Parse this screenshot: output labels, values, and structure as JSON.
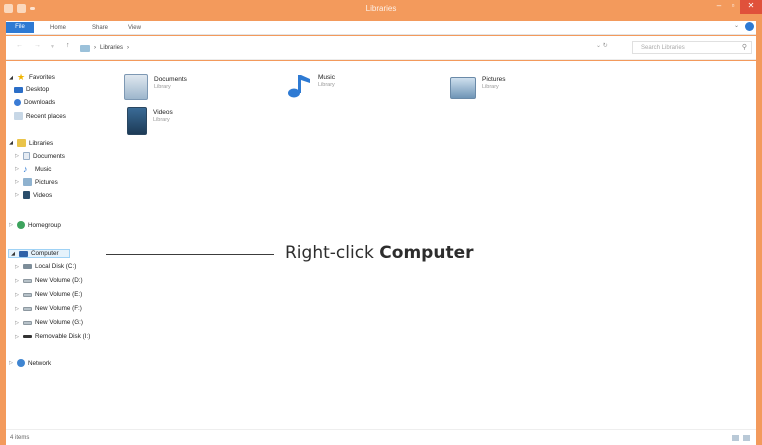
{
  "window": {
    "title": "Libraries",
    "controls": {
      "minimize": "–",
      "maximize": "▫",
      "close": "✕"
    },
    "accent_color": "#f39a5c"
  },
  "ribbon": {
    "tabs": {
      "file": "File",
      "home": "Home",
      "share": "Share",
      "view": "View"
    },
    "expand": "⌄"
  },
  "address_bar": {
    "path": "Libraries",
    "separator": "›",
    "refresh": "⌄  ↻",
    "search_placeholder": "Search Libraries"
  },
  "nav": {
    "favorites": {
      "label": "Favorites",
      "items": {
        "desktop": "Desktop",
        "downloads": "Downloads",
        "recent": "Recent places"
      }
    },
    "libraries": {
      "label": "Libraries",
      "items": {
        "documents": "Documents",
        "music": "Music",
        "pictures": "Pictures",
        "videos": "Videos"
      }
    },
    "homegroup": "Homegroup",
    "computer": {
      "label": "Computer",
      "drives": {
        "c": "Local Disk (C:)",
        "d": "New Volume (D:)",
        "e": "New Volume (E:)",
        "f": "New Volume (F:)",
        "g": "New Volume (G:)",
        "i": "Removable Disk (I:)"
      }
    },
    "network": "Network"
  },
  "tiles": {
    "documents": {
      "name": "Documents",
      "type": "Library"
    },
    "music": {
      "name": "Music",
      "type": "Library"
    },
    "pictures": {
      "name": "Pictures",
      "type": "Library"
    },
    "videos": {
      "name": "Videos",
      "type": "Library"
    }
  },
  "status": {
    "items": "4 items"
  },
  "callout": {
    "prefix": "Right-click ",
    "bold": "Computer"
  }
}
